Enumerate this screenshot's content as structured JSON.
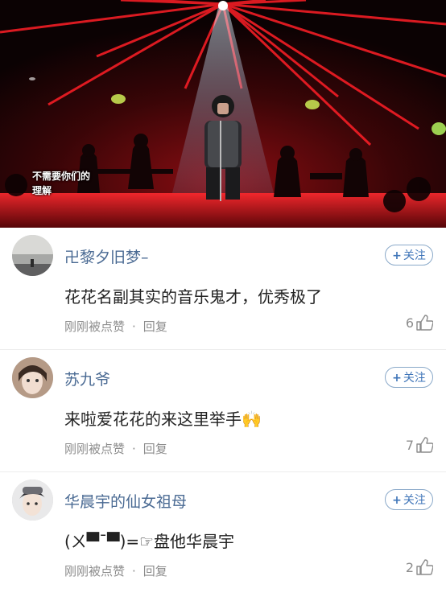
{
  "video": {
    "subtitle_line1": "不需要你们的",
    "subtitle_line2": "理解"
  },
  "comments": [
    {
      "username": "卍黎夕旧梦–",
      "follow_label": "关注",
      "content": "花花名副其实的音乐鬼才，优秀极了",
      "meta_time": "刚刚被点赞",
      "meta_separator": "·",
      "reply_label": "回复",
      "likes": "6"
    },
    {
      "username": "苏九爷",
      "follow_label": "关注",
      "content": "来啦爱花花的来这里举手",
      "emoji": "🙌",
      "meta_time": "刚刚被点赞",
      "meta_separator": "·",
      "reply_label": "回复",
      "likes": "7"
    },
    {
      "username": "华晨宇的仙女祖母",
      "follow_label": "关注",
      "content": "(ㄨ▀¯▀)=☞盘他华晨宇",
      "meta_time": "刚刚被点赞",
      "meta_separator": "·",
      "reply_label": "回复",
      "likes": "2"
    }
  ],
  "colors": {
    "username": "#4a6a93",
    "follow": "#3e74b8",
    "meta": "#8c8c8c",
    "stage_red": "#e0161e"
  }
}
